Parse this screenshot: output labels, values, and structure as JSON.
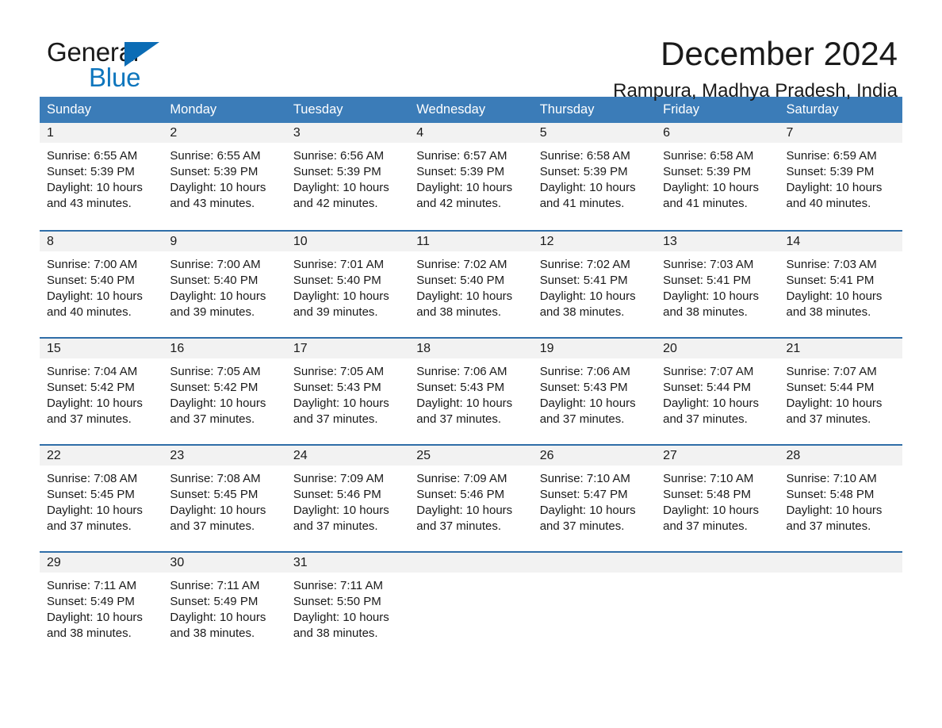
{
  "brand": {
    "name_part1": "General",
    "name_part2": "Blue",
    "triangle_icon": "triangle-icon",
    "accent_color": "#0e76bd"
  },
  "header": {
    "month_title": "December 2024",
    "location": "Rampura, Madhya Pradesh, India"
  },
  "calendar": {
    "header_bg": "#3b7cb8",
    "row_border": "#2f6ea8",
    "daynumber_bg": "#f2f2f2",
    "weekday_headers": [
      "Sunday",
      "Monday",
      "Tuesday",
      "Wednesday",
      "Thursday",
      "Friday",
      "Saturday"
    ],
    "weeks": [
      [
        {
          "day": "1",
          "sunrise": "Sunrise: 6:55 AM",
          "sunset": "Sunset: 5:39 PM",
          "daylight_l1": "Daylight: 10 hours",
          "daylight_l2": "and 43 minutes."
        },
        {
          "day": "2",
          "sunrise": "Sunrise: 6:55 AM",
          "sunset": "Sunset: 5:39 PM",
          "daylight_l1": "Daylight: 10 hours",
          "daylight_l2": "and 43 minutes."
        },
        {
          "day": "3",
          "sunrise": "Sunrise: 6:56 AM",
          "sunset": "Sunset: 5:39 PM",
          "daylight_l1": "Daylight: 10 hours",
          "daylight_l2": "and 42 minutes."
        },
        {
          "day": "4",
          "sunrise": "Sunrise: 6:57 AM",
          "sunset": "Sunset: 5:39 PM",
          "daylight_l1": "Daylight: 10 hours",
          "daylight_l2": "and 42 minutes."
        },
        {
          "day": "5",
          "sunrise": "Sunrise: 6:58 AM",
          "sunset": "Sunset: 5:39 PM",
          "daylight_l1": "Daylight: 10 hours",
          "daylight_l2": "and 41 minutes."
        },
        {
          "day": "6",
          "sunrise": "Sunrise: 6:58 AM",
          "sunset": "Sunset: 5:39 PM",
          "daylight_l1": "Daylight: 10 hours",
          "daylight_l2": "and 41 minutes."
        },
        {
          "day": "7",
          "sunrise": "Sunrise: 6:59 AM",
          "sunset": "Sunset: 5:39 PM",
          "daylight_l1": "Daylight: 10 hours",
          "daylight_l2": "and 40 minutes."
        }
      ],
      [
        {
          "day": "8",
          "sunrise": "Sunrise: 7:00 AM",
          "sunset": "Sunset: 5:40 PM",
          "daylight_l1": "Daylight: 10 hours",
          "daylight_l2": "and 40 minutes."
        },
        {
          "day": "9",
          "sunrise": "Sunrise: 7:00 AM",
          "sunset": "Sunset: 5:40 PM",
          "daylight_l1": "Daylight: 10 hours",
          "daylight_l2": "and 39 minutes."
        },
        {
          "day": "10",
          "sunrise": "Sunrise: 7:01 AM",
          "sunset": "Sunset: 5:40 PM",
          "daylight_l1": "Daylight: 10 hours",
          "daylight_l2": "and 39 minutes."
        },
        {
          "day": "11",
          "sunrise": "Sunrise: 7:02 AM",
          "sunset": "Sunset: 5:40 PM",
          "daylight_l1": "Daylight: 10 hours",
          "daylight_l2": "and 38 minutes."
        },
        {
          "day": "12",
          "sunrise": "Sunrise: 7:02 AM",
          "sunset": "Sunset: 5:41 PM",
          "daylight_l1": "Daylight: 10 hours",
          "daylight_l2": "and 38 minutes."
        },
        {
          "day": "13",
          "sunrise": "Sunrise: 7:03 AM",
          "sunset": "Sunset: 5:41 PM",
          "daylight_l1": "Daylight: 10 hours",
          "daylight_l2": "and 38 minutes."
        },
        {
          "day": "14",
          "sunrise": "Sunrise: 7:03 AM",
          "sunset": "Sunset: 5:41 PM",
          "daylight_l1": "Daylight: 10 hours",
          "daylight_l2": "and 38 minutes."
        }
      ],
      [
        {
          "day": "15",
          "sunrise": "Sunrise: 7:04 AM",
          "sunset": "Sunset: 5:42 PM",
          "daylight_l1": "Daylight: 10 hours",
          "daylight_l2": "and 37 minutes."
        },
        {
          "day": "16",
          "sunrise": "Sunrise: 7:05 AM",
          "sunset": "Sunset: 5:42 PM",
          "daylight_l1": "Daylight: 10 hours",
          "daylight_l2": "and 37 minutes."
        },
        {
          "day": "17",
          "sunrise": "Sunrise: 7:05 AM",
          "sunset": "Sunset: 5:43 PM",
          "daylight_l1": "Daylight: 10 hours",
          "daylight_l2": "and 37 minutes."
        },
        {
          "day": "18",
          "sunrise": "Sunrise: 7:06 AM",
          "sunset": "Sunset: 5:43 PM",
          "daylight_l1": "Daylight: 10 hours",
          "daylight_l2": "and 37 minutes."
        },
        {
          "day": "19",
          "sunrise": "Sunrise: 7:06 AM",
          "sunset": "Sunset: 5:43 PM",
          "daylight_l1": "Daylight: 10 hours",
          "daylight_l2": "and 37 minutes."
        },
        {
          "day": "20",
          "sunrise": "Sunrise: 7:07 AM",
          "sunset": "Sunset: 5:44 PM",
          "daylight_l1": "Daylight: 10 hours",
          "daylight_l2": "and 37 minutes."
        },
        {
          "day": "21",
          "sunrise": "Sunrise: 7:07 AM",
          "sunset": "Sunset: 5:44 PM",
          "daylight_l1": "Daylight: 10 hours",
          "daylight_l2": "and 37 minutes."
        }
      ],
      [
        {
          "day": "22",
          "sunrise": "Sunrise: 7:08 AM",
          "sunset": "Sunset: 5:45 PM",
          "daylight_l1": "Daylight: 10 hours",
          "daylight_l2": "and 37 minutes."
        },
        {
          "day": "23",
          "sunrise": "Sunrise: 7:08 AM",
          "sunset": "Sunset: 5:45 PM",
          "daylight_l1": "Daylight: 10 hours",
          "daylight_l2": "and 37 minutes."
        },
        {
          "day": "24",
          "sunrise": "Sunrise: 7:09 AM",
          "sunset": "Sunset: 5:46 PM",
          "daylight_l1": "Daylight: 10 hours",
          "daylight_l2": "and 37 minutes."
        },
        {
          "day": "25",
          "sunrise": "Sunrise: 7:09 AM",
          "sunset": "Sunset: 5:46 PM",
          "daylight_l1": "Daylight: 10 hours",
          "daylight_l2": "and 37 minutes."
        },
        {
          "day": "26",
          "sunrise": "Sunrise: 7:10 AM",
          "sunset": "Sunset: 5:47 PM",
          "daylight_l1": "Daylight: 10 hours",
          "daylight_l2": "and 37 minutes."
        },
        {
          "day": "27",
          "sunrise": "Sunrise: 7:10 AM",
          "sunset": "Sunset: 5:48 PM",
          "daylight_l1": "Daylight: 10 hours",
          "daylight_l2": "and 37 minutes."
        },
        {
          "day": "28",
          "sunrise": "Sunrise: 7:10 AM",
          "sunset": "Sunset: 5:48 PM",
          "daylight_l1": "Daylight: 10 hours",
          "daylight_l2": "and 37 minutes."
        }
      ],
      [
        {
          "day": "29",
          "sunrise": "Sunrise: 7:11 AM",
          "sunset": "Sunset: 5:49 PM",
          "daylight_l1": "Daylight: 10 hours",
          "daylight_l2": "and 38 minutes."
        },
        {
          "day": "30",
          "sunrise": "Sunrise: 7:11 AM",
          "sunset": "Sunset: 5:49 PM",
          "daylight_l1": "Daylight: 10 hours",
          "daylight_l2": "and 38 minutes."
        },
        {
          "day": "31",
          "sunrise": "Sunrise: 7:11 AM",
          "sunset": "Sunset: 5:50 PM",
          "daylight_l1": "Daylight: 10 hours",
          "daylight_l2": "and 38 minutes."
        },
        {
          "day": "",
          "sunrise": "",
          "sunset": "",
          "daylight_l1": "",
          "daylight_l2": ""
        },
        {
          "day": "",
          "sunrise": "",
          "sunset": "",
          "daylight_l1": "",
          "daylight_l2": ""
        },
        {
          "day": "",
          "sunrise": "",
          "sunset": "",
          "daylight_l1": "",
          "daylight_l2": ""
        },
        {
          "day": "",
          "sunrise": "",
          "sunset": "",
          "daylight_l1": "",
          "daylight_l2": ""
        }
      ]
    ]
  }
}
